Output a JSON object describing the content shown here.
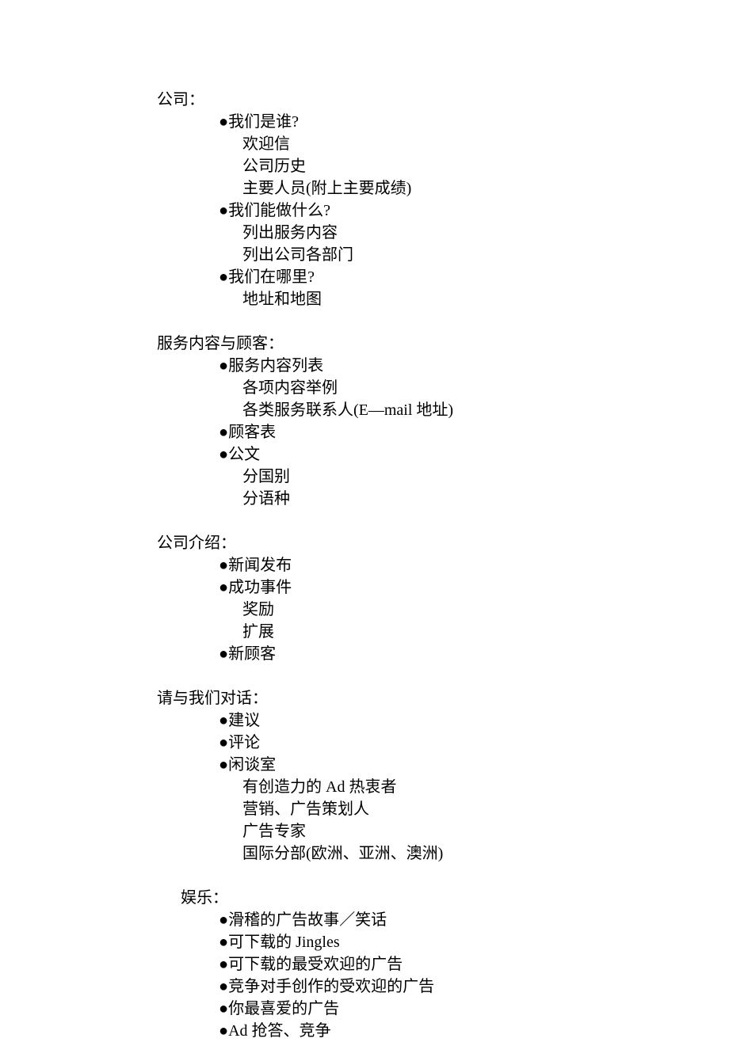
{
  "sections": [
    {
      "heading": "公司：",
      "items": [
        {
          "label": "我们是谁?",
          "children": [
            "欢迎信",
            "公司历史",
            "主要人员(附上主要成绩)"
          ]
        },
        {
          "label": "我们能做什么?",
          "children": [
            "列出服务内容",
            "列出公司各部门"
          ]
        },
        {
          "label": "我们在哪里?",
          "children": [
            "地址和地图"
          ]
        }
      ]
    },
    {
      "heading": "服务内容与顾客：",
      "items": [
        {
          "label": "服务内容列表",
          "children": [
            "各项内容举例",
            "各类服务联系人(E—mail 地址)"
          ]
        },
        {
          "label": "顾客表",
          "children": []
        },
        {
          "label": "公文",
          "children": [
            "分国别",
            "分语种"
          ]
        }
      ]
    },
    {
      "heading": "公司介绍：",
      "items": [
        {
          "label": "新闻发布",
          "children": []
        },
        {
          "label": "成功事件",
          "children": [
            "奖励",
            "扩展"
          ]
        },
        {
          "label": "新顾客",
          "children": []
        }
      ]
    },
    {
      "heading": "请与我们对话：",
      "items": [
        {
          "label": "建议",
          "children": []
        },
        {
          "label": "评论",
          "children": []
        },
        {
          "label": "闲谈室",
          "children": [
            "有创造力的 Ad 热衷者",
            "营销、广告策划人",
            "广告专家",
            "国际分部(欧洲、亚洲、澳洲)"
          ]
        }
      ]
    },
    {
      "heading": "娱乐：",
      "items": [
        {
          "label": "滑稽的广告故事／笑话",
          "children": []
        },
        {
          "label": "可下载的 Jingles",
          "children": []
        },
        {
          "label": "可下载的最受欢迎的广告",
          "children": []
        },
        {
          "label": "竞争对手创作的受欢迎的广告",
          "children": []
        },
        {
          "label": "你最喜爱的广告",
          "children": []
        },
        {
          "label": "Ad 抢答、竞争",
          "children": []
        }
      ]
    }
  ],
  "bullet": "●"
}
